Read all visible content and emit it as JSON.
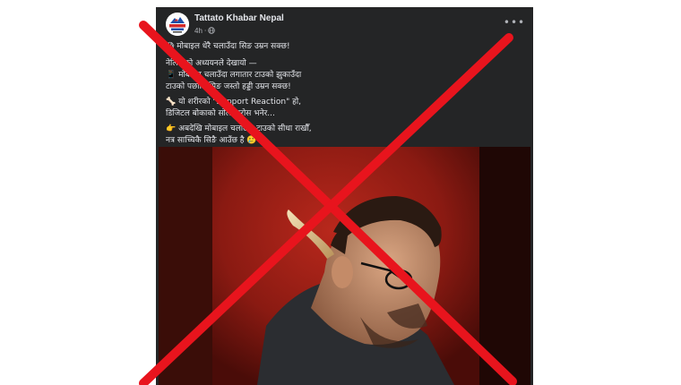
{
  "post": {
    "page_name": "Tattato Khabar Nepal",
    "time": "4h",
    "dot": "·",
    "paragraphs": [
      {
        "line1": "😱 मोबाइल धेरै चलाउँदा सिङ उम्रन सक्छ!",
        "line2": ""
      },
      {
        "line1": "नेलियाको अध्ययनले देखायो —",
        "line2": "📱 मोबाइल चलाउँदा लगातार टाउको झुकाउँदा"
      },
      {
        "line1": "टाउको पछाडि सिङ जस्तो हड्डी उम्रन सक्छ!",
        "line2": ""
      },
      {
        "line1": "🦴 यो शरीरको \"Support Reaction\" हो,",
        "line2": "डिजिटल बोकाको सोलो परोस भनेर..."
      },
      {
        "line1": "👉 अबदेखि मोबाइल चलाउँदा टाउको सीधा राखौँ,",
        "line2": "नत्र साच्चिकै सिङै आउँछ है 🥲"
      }
    ]
  },
  "icons": {
    "avatar": "tattato-khabar-logo",
    "globe": "globe-icon",
    "more": "more-options-icon"
  },
  "colors": {
    "card_bg": "#242526",
    "text_primary": "#e4e6eb",
    "text_secondary": "#b0b3b8",
    "cross": "#e8141d",
    "image_red": "#9b1c14"
  }
}
